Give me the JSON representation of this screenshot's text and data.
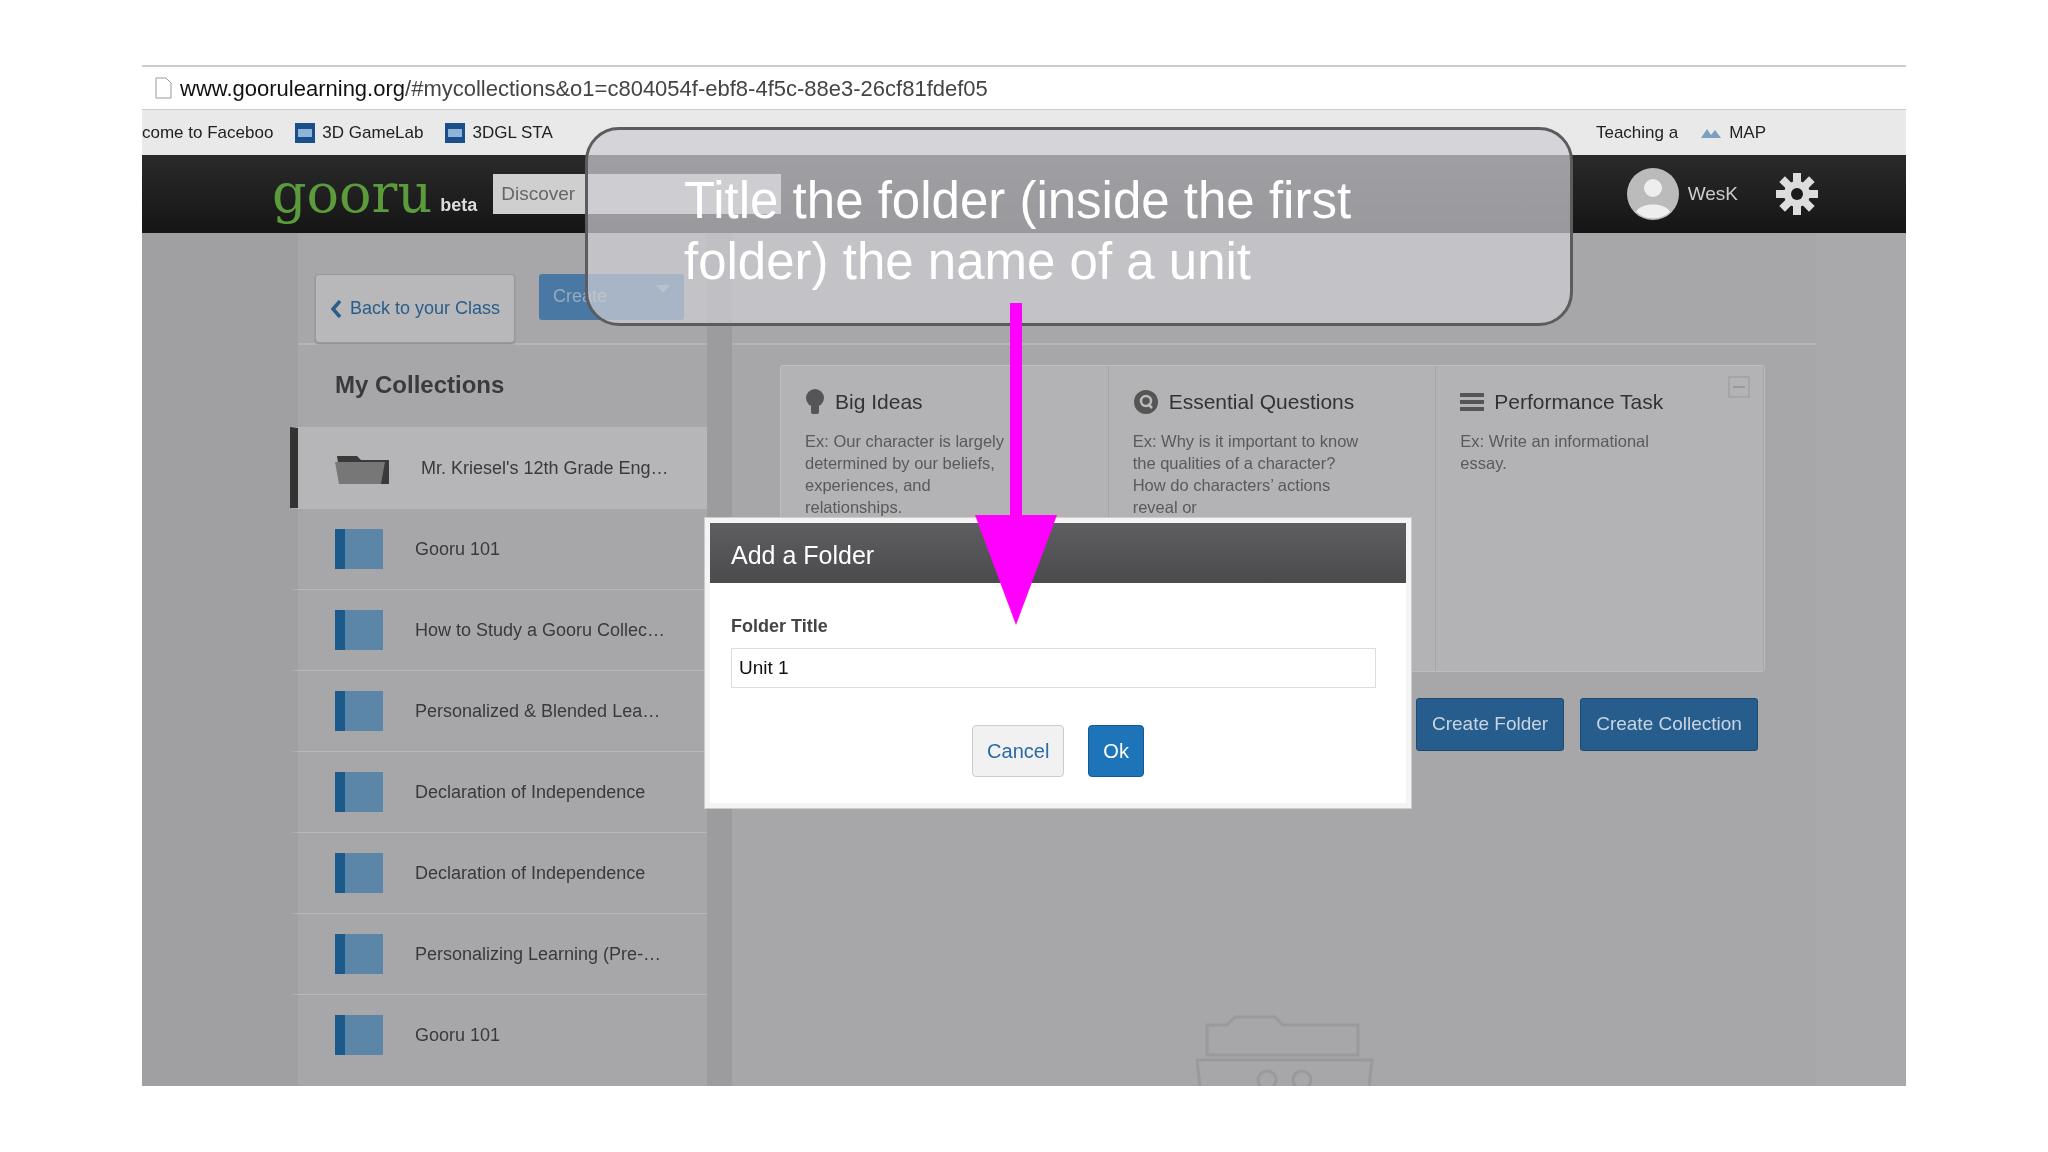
{
  "browser": {
    "url_domain": "www.goorulearning.org",
    "url_path": "/#mycollections&o1=c804054f-ebf8-4f5c-88e3-26cf81fdef05",
    "bookmarks_left": [
      {
        "label": "come to Faceboo",
        "kind": "none"
      },
      {
        "label": "3D GameLab",
        "kind": "gl"
      },
      {
        "label": "3DGL STA",
        "kind": "gl"
      }
    ],
    "bookmarks_right": [
      {
        "label": "Teaching a",
        "kind": "none"
      },
      {
        "label": "MAP",
        "kind": "nwea"
      }
    ]
  },
  "navbar": {
    "logo": "gooru",
    "badge": "beta",
    "search_placeholder": "Discover",
    "user": "WesK"
  },
  "toolbar": {
    "back": "Back to your Class",
    "create": "Create"
  },
  "sidebar": {
    "title": "My Collections",
    "items": [
      {
        "label": "Mr. Kriesel's 12th Grade Eng…",
        "kind": "folder",
        "selected": true
      },
      {
        "label": "Gooru 101",
        "kind": "collection",
        "selected": false
      },
      {
        "label": "How to Study a Gooru Collec…",
        "kind": "collection",
        "selected": false
      },
      {
        "label": "Personalized & Blended Lea…",
        "kind": "collection",
        "selected": false
      },
      {
        "label": "Declaration of Independence",
        "kind": "collection",
        "selected": false
      },
      {
        "label": "Declaration of Independence",
        "kind": "collection",
        "selected": false
      },
      {
        "label": "Personalizing Learning (Pre-…",
        "kind": "collection",
        "selected": false
      },
      {
        "label": "Gooru 101",
        "kind": "collection",
        "selected": false
      }
    ]
  },
  "panel": {
    "columns": [
      {
        "title": "Big Ideas",
        "text": "Ex: Our character is largely determined by our beliefs, experiences, and relationships."
      },
      {
        "title": "Essential Questions",
        "text": "Ex: Why is it important to know the qualities of a character? How do characters’ actions reveal or"
      },
      {
        "title": "Performance Task",
        "text": "Ex: Write an informational essay."
      }
    ]
  },
  "buttons": [
    "Create Folder",
    "Create Collection"
  ],
  "dialog": {
    "title": "Add a Folder",
    "label": "Folder Title",
    "value": "Unit 1",
    "buttons": [
      {
        "label": "Cancel",
        "kind": "secondary"
      },
      {
        "label": "Ok",
        "kind": "primary"
      }
    ]
  },
  "callout": {
    "text": "Title the folder (inside the first folder) the name of a unit"
  }
}
